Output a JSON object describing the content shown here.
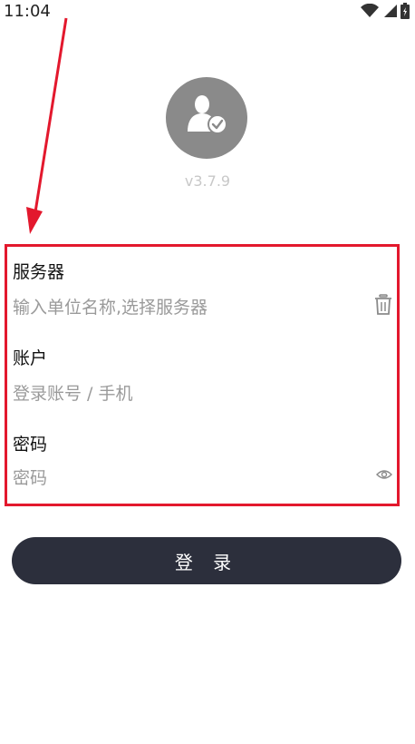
{
  "status_bar": {
    "time": "11:04",
    "icons": [
      "wifi-icon",
      "signal-icon",
      "battery-icon"
    ]
  },
  "app": {
    "version": "v3.7.9",
    "avatar_icon": "user-verified-icon"
  },
  "form": {
    "server": {
      "label": "服务器",
      "placeholder": "输入单位名称,选择服务器",
      "action_icon": "trash-icon"
    },
    "account": {
      "label": "账户",
      "placeholder": "登录账号 / 手机"
    },
    "password": {
      "label": "密码",
      "placeholder": "密码",
      "action_icon": "eye-icon"
    }
  },
  "login_button": {
    "label": "登 录"
  },
  "colors": {
    "annotation": "#e3182d",
    "button_bg": "#2c2f3c",
    "avatar_bg": "#8a8a8a",
    "placeholder": "#9a9a9a"
  }
}
